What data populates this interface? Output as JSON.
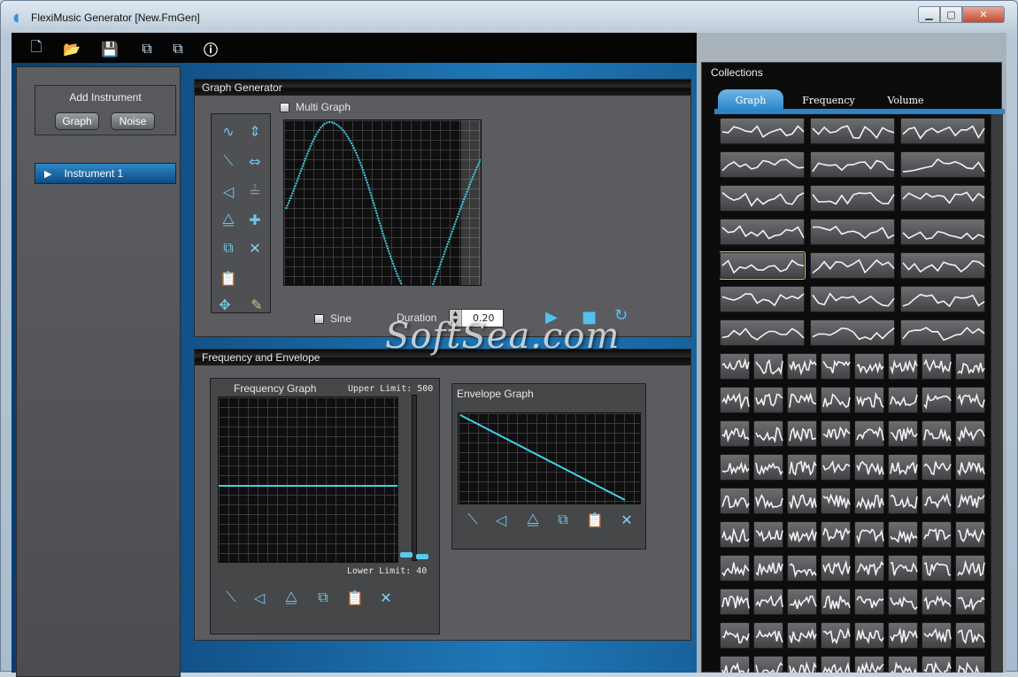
{
  "window": {
    "title": "FlexiMusic Generator [New.FmGen]",
    "app_icon": "wave-icon",
    "controls": [
      "minimize-icon",
      "maximize-icon",
      "close-icon"
    ]
  },
  "toolbar": {
    "buttons": [
      "new-file-icon",
      "open-folder-icon",
      "save-icon",
      "save-as-icon",
      "export-icon",
      "info-icon"
    ]
  },
  "left": {
    "add_instrument": "Add Instrument",
    "graph_btn": "Graph",
    "noise_btn": "Noise",
    "instrument": "Instrument 1"
  },
  "graph_generator": {
    "title": "Graph Generator",
    "multi_graph": "Multi Graph",
    "sine": "Sine",
    "duration_label": "Duration",
    "duration_value": "0.20"
  },
  "freq_env": {
    "title": "Frequency and Envelope",
    "freq_graph": "Frequency Graph",
    "upper_limit": "Upper Limit: 500",
    "lower_limit": "Lower Limit: 40",
    "envelope_graph": "Envelope Graph"
  },
  "collections": {
    "title": "Collections",
    "tabs": [
      "Graph",
      "Frequency",
      "Volume"
    ]
  },
  "watermark": "SoftSea.com",
  "accent": "#3fd3e6"
}
